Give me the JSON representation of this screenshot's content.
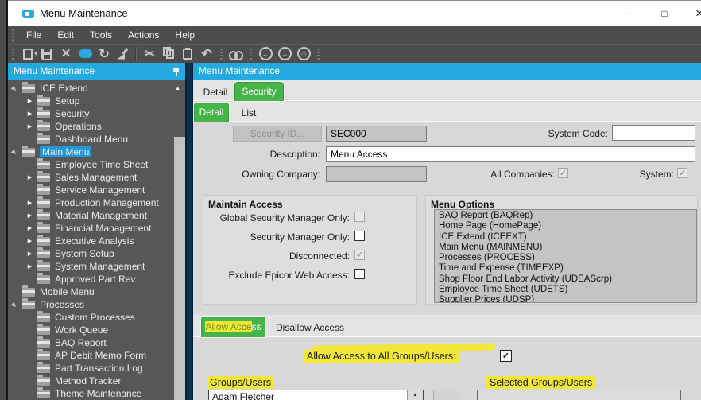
{
  "window": {
    "title": "Menu Maintenance"
  },
  "window_controls": {
    "minimize": "−",
    "maximize": "□",
    "close": "×"
  },
  "menu_bar": {
    "items": [
      "File",
      "Edit",
      "Tools",
      "Actions",
      "Help"
    ]
  },
  "toolbar": {
    "items": [
      {
        "name": "new",
        "glyph": ""
      },
      {
        "name": "new-dropdown",
        "glyph": "▾"
      },
      {
        "name": "save",
        "glyph": ""
      },
      {
        "name": "delete",
        "glyph": "×"
      },
      {
        "name": "comment",
        "glyph": ""
      },
      {
        "name": "refresh",
        "glyph": "↻"
      },
      {
        "name": "clear",
        "glyph": ""
      },
      {
        "name": "cut",
        "glyph": "✂"
      },
      {
        "name": "copy",
        "glyph": ""
      },
      {
        "name": "paste",
        "glyph": ""
      },
      {
        "name": "undo",
        "glyph": "↶"
      },
      {
        "name": "search",
        "glyph": ""
      },
      {
        "name": "back",
        "glyph": "←"
      },
      {
        "name": "forward",
        "glyph": "→"
      },
      {
        "name": "home",
        "glyph": "⌂"
      }
    ]
  },
  "left_panel": {
    "header": "Menu Maintenance",
    "scroll_up": "▲",
    "tree": {
      "items": [
        {
          "label": "ICE Extend",
          "level": 0,
          "arrow": "expanded",
          "selected": false
        },
        {
          "label": "Setup",
          "level": 1,
          "arrow": "collapsed",
          "selected": false
        },
        {
          "label": "Security",
          "level": 1,
          "arrow": "collapsed",
          "selected": false
        },
        {
          "label": "Operations",
          "level": 1,
          "arrow": "collapsed",
          "selected": false
        },
        {
          "label": "Dashboard Menu",
          "level": 1,
          "arrow": "none",
          "selected": false
        },
        {
          "label": "Main Menu",
          "level": 0,
          "arrow": "expanded",
          "selected": true
        },
        {
          "label": "Employee Time Sheet",
          "level": 1,
          "arrow": "none",
          "selected": false
        },
        {
          "label": "Sales Management",
          "level": 1,
          "arrow": "collapsed",
          "selected": false
        },
        {
          "label": "Service Management",
          "level": 1,
          "arrow": "none",
          "selected": false
        },
        {
          "label": "Production Management",
          "level": 1,
          "arrow": "collapsed",
          "selected": false
        },
        {
          "label": "Material Management",
          "level": 1,
          "arrow": "collapsed",
          "selected": false
        },
        {
          "label": "Financial Management",
          "level": 1,
          "arrow": "collapsed",
          "selected": false
        },
        {
          "label": "Executive Analysis",
          "level": 1,
          "arrow": "collapsed",
          "selected": false
        },
        {
          "label": "System Setup",
          "level": 1,
          "arrow": "collapsed",
          "selected": false
        },
        {
          "label": "System Management",
          "level": 1,
          "arrow": "collapsed",
          "selected": false
        },
        {
          "label": "Approved Part Rev",
          "level": 1,
          "arrow": "none",
          "selected": false
        },
        {
          "label": "Mobile Menu",
          "level": 0,
          "arrow": "none",
          "selected": false
        },
        {
          "label": "Processes",
          "level": 0,
          "arrow": "expanded",
          "selected": false
        },
        {
          "label": "Custom Processes",
          "level": 1,
          "arrow": "none",
          "selected": false
        },
        {
          "label": "Work Queue",
          "level": 1,
          "arrow": "none",
          "selected": false
        },
        {
          "label": "BAQ Report",
          "level": 1,
          "arrow": "none",
          "selected": false
        },
        {
          "label": "AP Debit Memo Form",
          "level": 1,
          "arrow": "none",
          "selected": false
        },
        {
          "label": "Part Transaction Log",
          "level": 1,
          "arrow": "none",
          "selected": false
        },
        {
          "label": "Method Tracker",
          "level": 1,
          "arrow": "none",
          "selected": false
        },
        {
          "label": "Theme Maintenance",
          "level": 1,
          "arrow": "none",
          "selected": false
        }
      ]
    }
  },
  "right_panel": {
    "header": "Menu Maintenance",
    "outer_tabs": {
      "detail": "Detail",
      "security": "Security"
    },
    "inner_tabs": {
      "detail": "Detail",
      "list": "List"
    },
    "form": {
      "security_id_button": "Security ID...",
      "security_id_value": "SEC000",
      "system_code_label": "System Code:",
      "system_code_value": "",
      "description_label": "Description:",
      "description_value": "Menu Access",
      "owning_company_label": "Owning Company:",
      "owning_company_value": "",
      "all_companies_label": "All Companies:",
      "all_companies_checked": true,
      "system_label": "System:",
      "system_checked": true
    },
    "maintain_access": {
      "title": "Maintain Access",
      "items": [
        {
          "label": "Global Security Manager Only:",
          "checked": false,
          "enabled": false
        },
        {
          "label": "Security Manager Only:",
          "checked": false,
          "enabled": true
        },
        {
          "label": "Disconnected:",
          "checked": true,
          "enabled": false
        },
        {
          "label": "Exclude Epicor Web Access:",
          "checked": false,
          "enabled": true
        }
      ]
    },
    "menu_options": {
      "title": "Menu Options",
      "items": [
        "BAQ Report (BAQRep)",
        "Home Page (HomePage)",
        "ICE Extend (ICEEXT)",
        "Main Menu (MAINMENU)",
        "Processes (PROCESS)",
        "Time and Expense (TIMEEXP)",
        "Shop Floor End Labor Activity (UDEAScrp)",
        "Employee Time Sheet (UDETS)",
        "Supplier Prices (UDSP)"
      ]
    },
    "access_tabs": {
      "allow_left": "Allow Acce",
      "allow_right": "ss",
      "disallow": "Disallow Access"
    },
    "allow_all": {
      "label": "Allow Access to All Groups/Users:",
      "checked": true
    },
    "groups_users": {
      "label": "Groups/Users",
      "items": [
        "Adam Fletcher"
      ],
      "scroll_up": "▲"
    },
    "selected_groups": {
      "label": "Selected Groups/Users",
      "items": []
    }
  },
  "colors": {
    "accent_blue": "#24A9E1",
    "active_green": "#45B549",
    "highlight_yellow": "#F2E738",
    "dark_bar": "#4D4D4D",
    "tree_bg": "#575757",
    "divider_navy": "#0C3050"
  }
}
